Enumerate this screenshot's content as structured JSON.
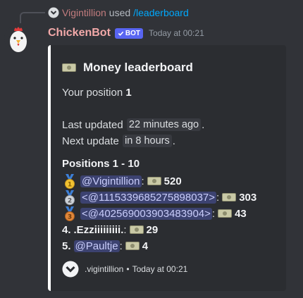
{
  "reply": {
    "user": "Vigintillion",
    "verb": "used",
    "command": "/leaderboard"
  },
  "message": {
    "username": "ChickenBot",
    "bot_tag": "BOT",
    "timestamp": "Today at 00:21"
  },
  "embed": {
    "accent_color": "#ffffff",
    "title": "Money leaderboard",
    "your_position_label": "Your position",
    "your_position_value": "1",
    "last_updated_label": "Last updated",
    "last_updated_value": "22 minutes ago",
    "next_update_label": "Next update",
    "next_update_value": "in 8 hours",
    "positions_heading": "Positions 1 - 10",
    "entries": [
      {
        "rank": "1",
        "medal": "gold",
        "name": "@Vigintillion",
        "amount": "520"
      },
      {
        "rank": "2",
        "medal": "silver",
        "name": "<@1115339685275898037>",
        "amount": "303"
      },
      {
        "rank": "3",
        "medal": "bronze",
        "name": "<@402569003903483904>",
        "amount": "43"
      },
      {
        "rank": "4.",
        "name": ".Ezziiiiiiiii.",
        "amount": "29"
      },
      {
        "rank": "5.",
        "name": "@Paultje",
        "amount": "4"
      }
    ],
    "footer": {
      "author": ".vigintillion",
      "separator": "•",
      "timestamp": "Today at 00:21"
    }
  },
  "colors": {
    "background": "#313338",
    "embed_background": "#2b2d31",
    "username": "#f2a9a9",
    "bot_tag": "#5865f2",
    "mention_bg": "#3c4270",
    "command_link": "#00a8fc"
  }
}
